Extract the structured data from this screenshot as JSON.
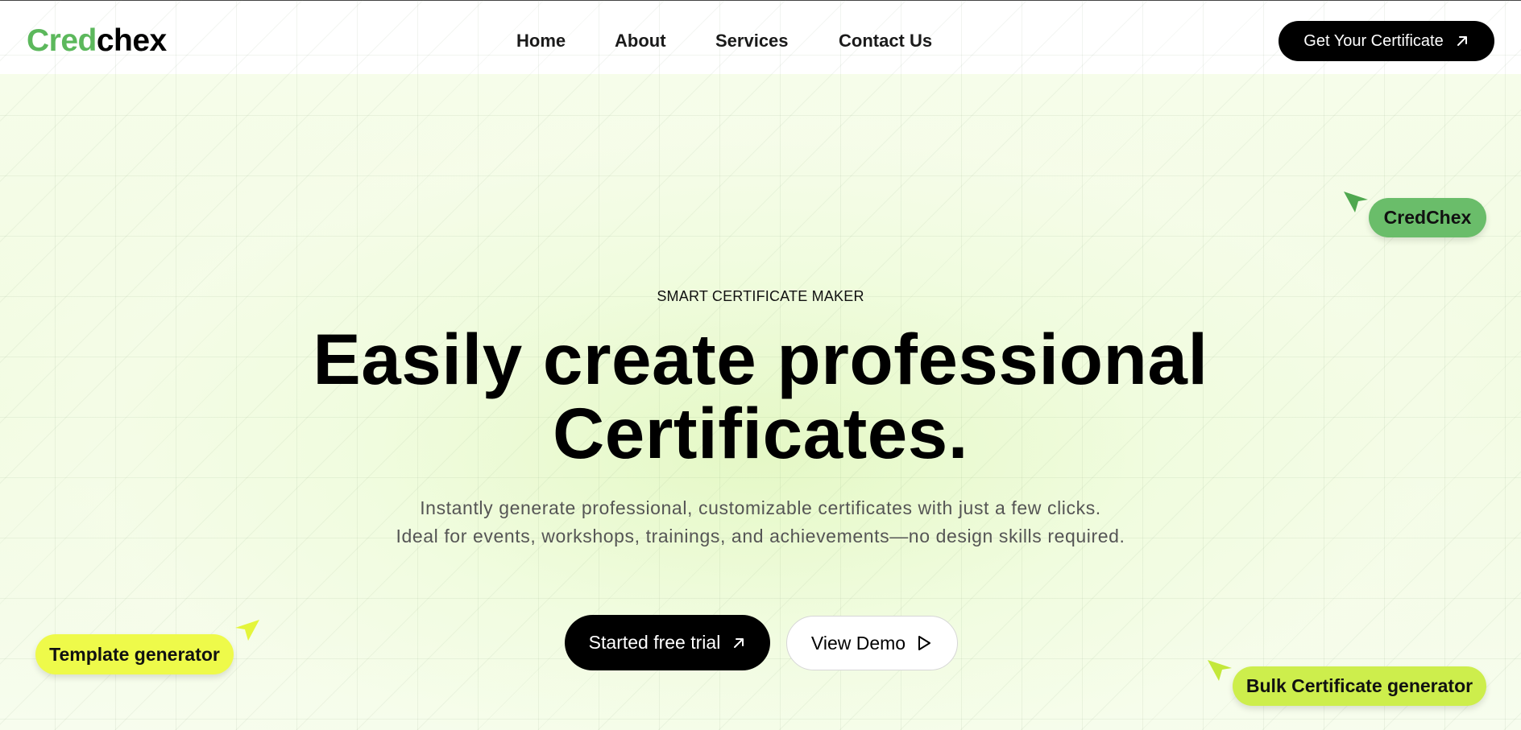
{
  "brand": {
    "logo_part1": "Cred",
    "logo_part2": "chex",
    "logo_color_primary": "#5cb85c",
    "logo_color_secondary": "#000000"
  },
  "nav": {
    "items": [
      {
        "label": "Home"
      },
      {
        "label": "About"
      },
      {
        "label": "Services"
      },
      {
        "label": "Contact Us"
      }
    ],
    "cta_label": "Get Your Certificate",
    "cta_icon": "arrow-up-right-icon"
  },
  "hero": {
    "eyebrow": "SMART CERTIFICATE MAKER",
    "headline_line1": "Easily create professional",
    "headline_line2": "Certificates.",
    "sub_line1": "Instantly generate professional, customizable certificates with just a few clicks.",
    "sub_line2": "Ideal for events, workshops, trainings, and achievements—no design skills required.",
    "primary_button": "Started free trial",
    "primary_icon": "arrow-up-right-icon",
    "secondary_button": "View Demo",
    "secondary_icon": "play-outline-icon"
  },
  "tags": {
    "credchex": "CredChex",
    "template": "Template generator",
    "bulk": "Bulk Certificate generator"
  },
  "colors": {
    "tag_credchex": "#6abd6a",
    "tag_template": "#eefa4a",
    "tag_bulk": "#cdee4c",
    "accent_black": "#000000"
  }
}
